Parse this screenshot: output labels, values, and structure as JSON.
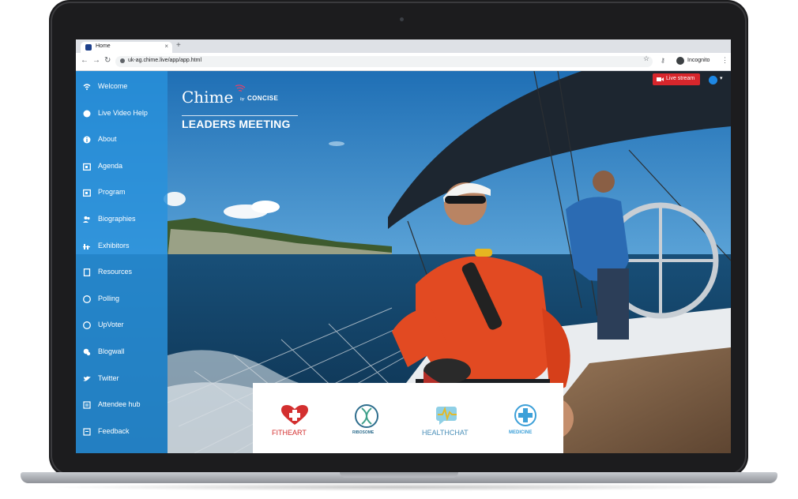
{
  "browser": {
    "tab_title": "Home",
    "url": "uk-ag.chime.live/app/app.html",
    "incognito_label": "Incognito"
  },
  "sidebar": {
    "items": [
      {
        "label": "Welcome",
        "icon": "wifi-icon"
      },
      {
        "label": "Live Video Help",
        "icon": "help-icon"
      },
      {
        "label": "About",
        "icon": "info-icon"
      },
      {
        "label": "Agenda",
        "icon": "calendar-icon"
      },
      {
        "label": "Program",
        "icon": "calendar-icon"
      },
      {
        "label": "Biographies",
        "icon": "people-icon"
      },
      {
        "label": "Exhibitors",
        "icon": "exhibitors-icon"
      },
      {
        "label": "Resources",
        "icon": "document-icon"
      },
      {
        "label": "Polling",
        "icon": "chat-poll-icon"
      },
      {
        "label": "UpVoter",
        "icon": "chat-icon"
      },
      {
        "label": "Blogwall",
        "icon": "chat-bubbles-icon"
      },
      {
        "label": "Twitter",
        "icon": "twitter-icon"
      },
      {
        "label": "Attendee hub",
        "icon": "list-icon"
      },
      {
        "label": "Feedback",
        "icon": "feedback-icon"
      }
    ]
  },
  "brand": {
    "name": "Chime",
    "by": "by",
    "org": "CONCISE",
    "subtitle": "LEADERS MEETING"
  },
  "header": {
    "live_stream_label": "Live stream"
  },
  "sponsors": [
    {
      "name": "FITHEART",
      "color": "#d32f2f"
    },
    {
      "name": "RIBOSOME",
      "color": "#2f6e8e"
    },
    {
      "name": "HEALTHCHAT",
      "color": "#4a8fb8"
    },
    {
      "name": "MEDICINE",
      "color": "#3da0d8"
    }
  ],
  "colors": {
    "sidebar": "#2891dc",
    "live_button": "#d7262c",
    "avatar": "#1e88e5"
  }
}
